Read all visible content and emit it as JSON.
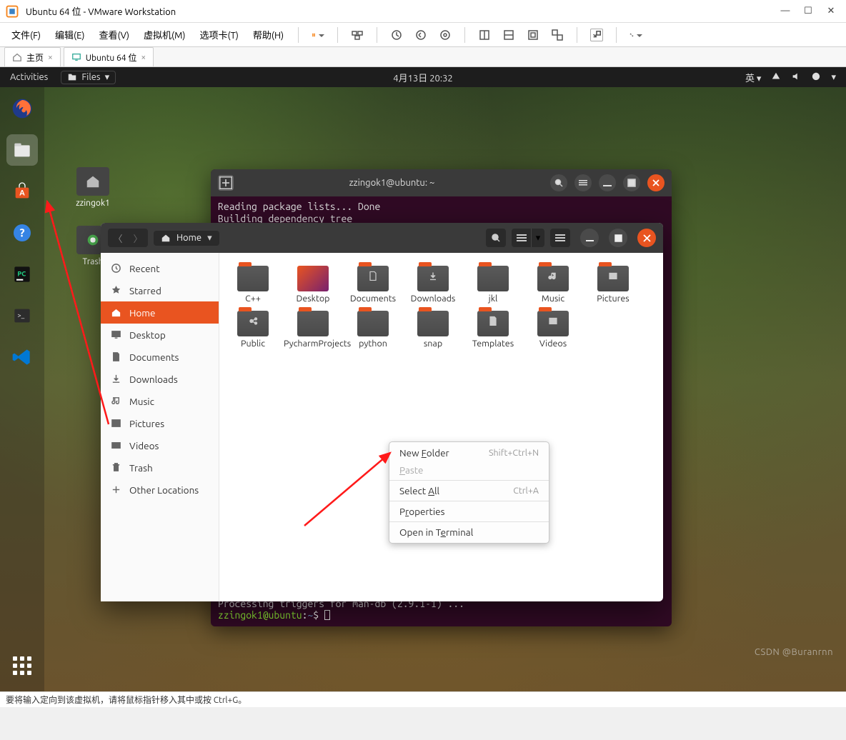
{
  "vmware": {
    "title": "Ubuntu 64 位 - VMware Workstation",
    "menus": [
      "文件(F)",
      "编辑(E)",
      "查看(V)",
      "虚拟机(M)",
      "选项卡(T)",
      "帮助(H)"
    ],
    "tabs": {
      "home": "主页",
      "vm": "Ubuntu 64 位"
    },
    "status": "要将输入定向到该虚拟机，请将鼠标指针移入其中或按 Ctrl+G。"
  },
  "topbar": {
    "activities": "Activities",
    "files": "Files",
    "clock": "4月13日  20:32",
    "lang": "英"
  },
  "desktop": {
    "icon1": "zzingok1",
    "icon2": "Trash"
  },
  "terminal": {
    "title": "zzingok1@ubuntu: ~",
    "line1": "Reading package lists... Done",
    "line2": "Building dependency tree",
    "foot1": "Processing triggers for man-db (2.9.1-1) ...",
    "prompt_user": "zzingok1@ubuntu",
    "prompt_path": "~",
    "prompt_sep": ":",
    "prompt_end": "$"
  },
  "nautilus": {
    "location": "Home",
    "sidebar": [
      "Recent",
      "Starred",
      "Home",
      "Desktop",
      "Documents",
      "Downloads",
      "Music",
      "Pictures",
      "Videos",
      "Trash",
      "Other Locations"
    ],
    "folders": [
      "C++",
      "Desktop",
      "Documents",
      "Downloads",
      "jkl",
      "Music",
      "Pictures",
      "Public",
      "PycharmProjects",
      "python",
      "snap",
      "Templates",
      "Videos"
    ]
  },
  "ctx": {
    "new_folder": "New Folder",
    "new_folder_sc": "Shift+Ctrl+N",
    "paste": "Paste",
    "select_all": "Select All",
    "select_all_sc": "Ctrl+A",
    "properties": "Properties",
    "open_terminal": "Open in Terminal"
  },
  "watermark": "CSDN @Buranrnn"
}
